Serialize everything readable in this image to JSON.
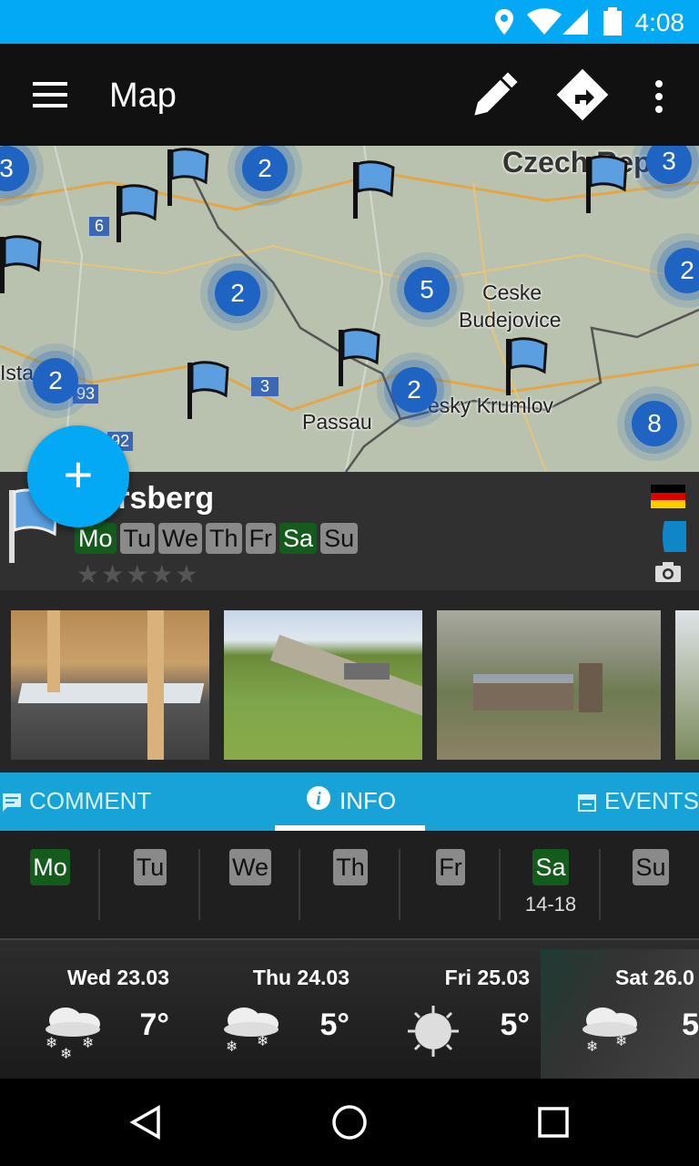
{
  "status_bar": {
    "time": "4:08"
  },
  "app_bar": {
    "title": "Map"
  },
  "map": {
    "labels": {
      "czech": "Czech Rep",
      "ceske1": "Ceske",
      "ceske2": "Budejovice",
      "passau": "Passau",
      "krumlov": "esky Krumlov",
      "ista": "Ista",
      "road6": "6",
      "road3": "3",
      "road93": "93",
      "road92": "92"
    },
    "clusters": [
      "3",
      "2",
      "3",
      "2",
      "5",
      "2",
      "2",
      "2",
      "8"
    ]
  },
  "place": {
    "name": "isersberg",
    "days": [
      {
        "label": "Mo",
        "open": true
      },
      {
        "label": "Tu",
        "open": false
      },
      {
        "label": "We",
        "open": false
      },
      {
        "label": "Th",
        "open": false
      },
      {
        "label": "Fr",
        "open": false
      },
      {
        "label": "Sa",
        "open": true
      },
      {
        "label": "Su",
        "open": false
      }
    ],
    "rating": "★★★★★",
    "colors": {
      "open": "#145c1c",
      "closed": "#8a8a8a"
    }
  },
  "tabs": {
    "comment": "COMMENT",
    "info": "INFO",
    "events": "EVENTS"
  },
  "week": {
    "mo": "Mo",
    "tu": "Tu",
    "we": "We",
    "th": "Th",
    "fr": "Fr",
    "sa": "Sa",
    "su": "Su",
    "sa_hours": "14-18"
  },
  "weather": [
    {
      "date": "Wed 23.03",
      "temp": "7°",
      "icon": "snow-cloud-icon"
    },
    {
      "date": "Thu 24.03",
      "temp": "5°",
      "icon": "snow-cloud-icon"
    },
    {
      "date": "Fri 25.03",
      "temp": "5°",
      "icon": "sun-icon"
    },
    {
      "date": "Sat 26.0",
      "temp": "5",
      "icon": "snow-cloud-icon"
    }
  ]
}
